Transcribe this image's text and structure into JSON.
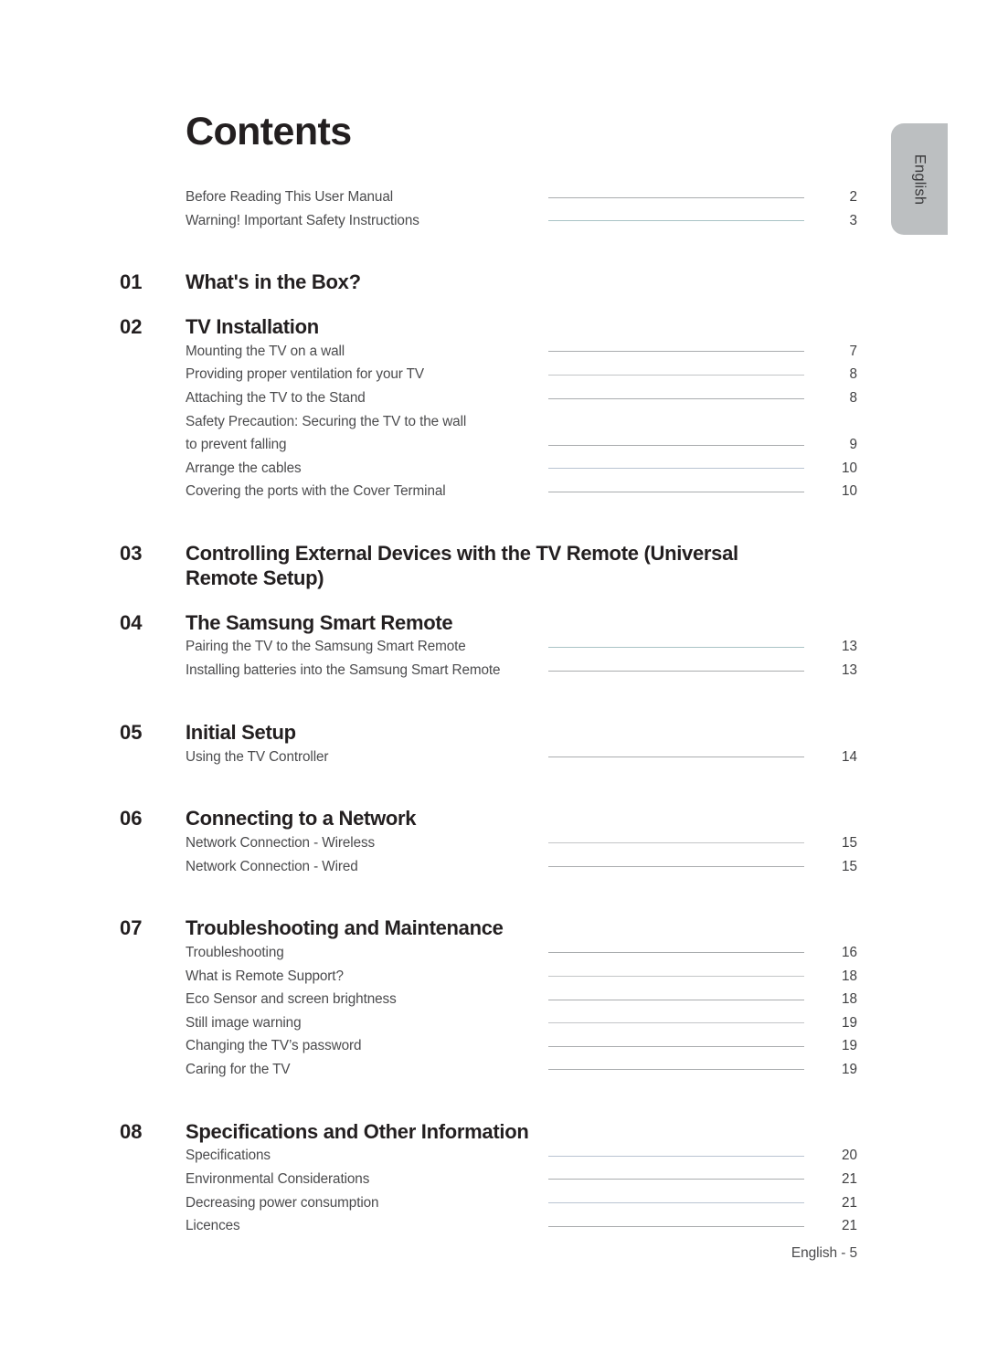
{
  "document": {
    "title": "Contents",
    "footer": "English - 5",
    "side_tab_label": "English"
  },
  "intro_entries": [
    {
      "label": "Before Reading This User Manual",
      "page": "2",
      "leader": "solid"
    },
    {
      "label": "Warning! Important Safety Instructions",
      "page": "3",
      "leader": "teal"
    }
  ],
  "sections": [
    {
      "number": "01",
      "title": "What's in the Box?",
      "entries": []
    },
    {
      "number": "02",
      "title": "TV Installation",
      "entries": [
        {
          "label": "Mounting the TV on a wall",
          "page": "7",
          "leader": "solid"
        },
        {
          "label": "Providing proper ventilation for your TV",
          "page": "8",
          "leader": "light"
        },
        {
          "label": "Attaching the TV to the Stand",
          "page": "8",
          "leader": "solid"
        },
        {
          "label": "Safety Precaution: Securing the TV to the wall",
          "page": "",
          "leader": "none"
        },
        {
          "label": "to prevent falling",
          "page": "9",
          "leader": "solid"
        },
        {
          "label": "Arrange the cables",
          "page": "10",
          "leader": "blue"
        },
        {
          "label": "Covering the ports with the Cover Terminal",
          "page": "10",
          "leader": "solid"
        }
      ]
    },
    {
      "number": "03",
      "title": "Controlling External Devices with the TV Remote (Universal Remote Setup)",
      "entries": []
    },
    {
      "number": "04",
      "title": "The Samsung Smart Remote",
      "entries": [
        {
          "label": "Pairing the TV to the Samsung Smart Remote",
          "page": "13",
          "leader": "teal"
        },
        {
          "label": "Installing batteries into the Samsung Smart Remote",
          "page": "13",
          "leader": "solid"
        }
      ]
    },
    {
      "number": "05",
      "title": "Initial Setup",
      "entries": [
        {
          "label": "Using the TV Controller",
          "page": "14",
          "leader": "solid"
        }
      ]
    },
    {
      "number": "06",
      "title": "Connecting to a Network",
      "entries": [
        {
          "label": "Network Connection - Wireless",
          "page": "15",
          "leader": "light"
        },
        {
          "label": "Network Connection - Wired",
          "page": "15",
          "leader": "solid"
        }
      ]
    },
    {
      "number": "07",
      "title": "Troubleshooting and Maintenance",
      "entries": [
        {
          "label": "Troubleshooting",
          "page": "16",
          "leader": "solid"
        },
        {
          "label": "What is Remote Support?",
          "page": "18",
          "leader": "light"
        },
        {
          "label": "Eco Sensor and screen brightness",
          "page": "18",
          "leader": "solid"
        },
        {
          "label": "Still image warning",
          "page": "19",
          "leader": "light"
        },
        {
          "label": "Changing the TV’s password",
          "page": "19",
          "leader": "solid"
        },
        {
          "label": "Caring for the TV",
          "page": "19",
          "leader": "solid"
        }
      ]
    },
    {
      "number": "08",
      "title": "Specifications and Other Information",
      "entries": [
        {
          "label": "Specifications",
          "page": "20",
          "leader": "blue"
        },
        {
          "label": "Environmental Considerations",
          "page": "21",
          "leader": "solid"
        },
        {
          "label": "Decreasing power consumption",
          "page": "21",
          "leader": "blue"
        },
        {
          "label": "Licences",
          "page": "21",
          "leader": "solid"
        }
      ]
    }
  ]
}
